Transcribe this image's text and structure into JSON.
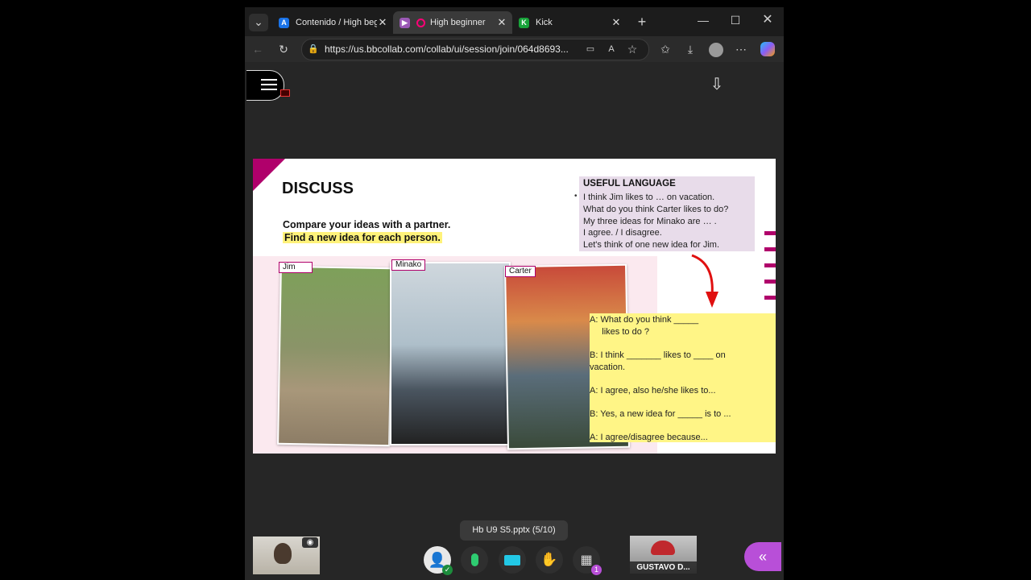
{
  "browser": {
    "tabs": [
      {
        "title": "Contenido / High beginner",
        "favicon": "A",
        "favicon_color": "#1a73e8"
      },
      {
        "title": "High beginner",
        "favicon": "",
        "favicon_color": "#9b59b6"
      },
      {
        "title": "Kick",
        "favicon": "K",
        "favicon_color": "#18a33a"
      }
    ],
    "url": "https://us.bbcollab.com/collab/ui/session/join/064d8693..."
  },
  "slide": {
    "title": "DISCUSS",
    "instruction_1": "Compare your ideas with a partner.",
    "instruction_2": "Find a new idea for each person.",
    "useful_language": {
      "title": "USEFUL LANGUAGE",
      "lines": [
        "I think Jim likes to … on vacation.",
        "What do you think Carter likes to do?",
        "My three ideas for Minako are … .",
        "I agree. / I disagree.",
        "Let's think of one new idea for Jim."
      ]
    },
    "people": [
      "Jim",
      "Minako",
      "Carter"
    ],
    "note_lines": [
      "A: What do you think _____",
      "     likes to do ?",
      "B: I think _______ likes to ____ on",
      "vacation.",
      "A: I agree, also he/she likes to...",
      "B: Yes, a new idea for _____ is to ...",
      "A: I agree/disagree because..."
    ]
  },
  "session": {
    "file_label": "Hb U9 S5.pptx   (5/10)",
    "participant_name": "GUSTAVO D...",
    "badge_count": "1"
  },
  "colors": {
    "accent_purple": "#b84fd8",
    "slide_pink": "#b0006b",
    "note_yellow": "#fff586"
  }
}
